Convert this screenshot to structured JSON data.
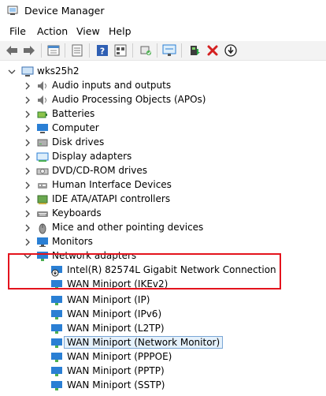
{
  "window": {
    "title": "Device Manager"
  },
  "menu": [
    "File",
    "Action",
    "View",
    "Help"
  ],
  "toolbar": {
    "icons": [
      "back-arrow-icon",
      "forward-arrow-icon",
      "properties-icon",
      "show-hide-icon",
      "help-icon",
      "view-by-icon",
      "scan-hardware-icon",
      "monitor-icon",
      "update-driver-icon",
      "uninstall-icon",
      "disable-device-icon"
    ]
  },
  "tree": {
    "root": "wks25h2",
    "categories": [
      "Audio inputs and outputs",
      "Audio Processing Objects (APOs)",
      "Batteries",
      "Computer",
      "Disk drives",
      "Display adapters",
      "DVD/CD-ROM drives",
      "Human Interface Devices",
      "IDE ATA/ATAPI controllers",
      "Keyboards",
      "Mice and other pointing devices",
      "Monitors",
      "Network adapters"
    ],
    "network_adapters": [
      "Intel(R) 82574L Gigabit Network Connection",
      "WAN Miniport (IKEv2)",
      "WAN Miniport (IP)",
      "WAN Miniport (IPv6)",
      "WAN Miniport (L2TP)",
      "WAN Miniport (Network Monitor)",
      "WAN Miniport (PPPOE)",
      "WAN Miniport (PPTP)",
      "WAN Miniport (SSTP)"
    ],
    "selected": "WAN Miniport (Network Monitor)"
  },
  "colors": {
    "highlight_box": "#e4131d",
    "selection": "#e5f1fb",
    "accent": "#2a7fd4"
  }
}
